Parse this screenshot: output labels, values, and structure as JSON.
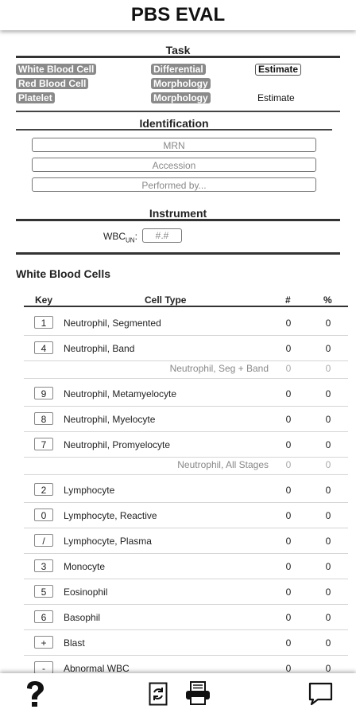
{
  "header": {
    "title": "PBS EVAL"
  },
  "task": {
    "title": "Task",
    "rows": [
      {
        "type": "White Blood Cell",
        "method": "Differential",
        "action": "Estimate",
        "action_style": "button"
      },
      {
        "type": "Red Blood Cell",
        "method": "Morphology",
        "action": "",
        "action_style": "none"
      },
      {
        "type": "Platelet",
        "method": "Morphology",
        "action": "Estimate",
        "action_style": "plain"
      }
    ]
  },
  "identification": {
    "title": "Identification",
    "mrn_placeholder": "MRN",
    "accession_placeholder": "Accession",
    "performed_by_placeholder": "Performed by..."
  },
  "instrument": {
    "title": "Instrument",
    "wbc_label": "WBC",
    "wbc_sub": "UN",
    "wbc_colon": ":",
    "wbc_placeholder": "#.#"
  },
  "wbc_section": {
    "title": "White Blood Cells",
    "headers": {
      "key": "Key",
      "cell_type": "Cell Type",
      "count": "#",
      "percent": "%"
    },
    "rows": [
      {
        "key": "1",
        "name": "Neutrophil, Segmented",
        "count": "0",
        "percent": "0",
        "subtotal": false
      },
      {
        "key": "4",
        "name": "Neutrophil, Band",
        "count": "0",
        "percent": "0",
        "subtotal": false
      },
      {
        "key": "",
        "name": "Neutrophil, Seg + Band",
        "count": "0",
        "percent": "0",
        "subtotal": true
      },
      {
        "key": "9",
        "name": "Neutrophil, Metamyelocyte",
        "count": "0",
        "percent": "0",
        "subtotal": false
      },
      {
        "key": "8",
        "name": "Neutrophil, Myelocyte",
        "count": "0",
        "percent": "0",
        "subtotal": false
      },
      {
        "key": "7",
        "name": "Neutrophil, Promyelocyte",
        "count": "0",
        "percent": "0",
        "subtotal": false
      },
      {
        "key": "",
        "name": "Neutrophil, All Stages",
        "count": "0",
        "percent": "0",
        "subtotal": true
      },
      {
        "key": "2",
        "name": "Lymphocyte",
        "count": "0",
        "percent": "0",
        "subtotal": false
      },
      {
        "key": "0",
        "name": "Lymphocyte, Reactive",
        "count": "0",
        "percent": "0",
        "subtotal": false
      },
      {
        "key": "/",
        "name": "Lymphocyte, Plasma",
        "count": "0",
        "percent": "0",
        "subtotal": false
      },
      {
        "key": "3",
        "name": "Monocyte",
        "count": "0",
        "percent": "0",
        "subtotal": false
      },
      {
        "key": "5",
        "name": "Eosinophil",
        "count": "0",
        "percent": "0",
        "subtotal": false
      },
      {
        "key": "6",
        "name": "Basophil",
        "count": "0",
        "percent": "0",
        "subtotal": false
      },
      {
        "key": "+",
        "name": "Blast",
        "count": "0",
        "percent": "0",
        "subtotal": false
      },
      {
        "key": "-",
        "name": "Abnormal WBC",
        "count": "0",
        "percent": "0",
        "subtotal": false
      }
    ]
  },
  "footer": {
    "icons": [
      "help-icon",
      "refresh-icon",
      "print-icon",
      "chat-icon"
    ]
  }
}
